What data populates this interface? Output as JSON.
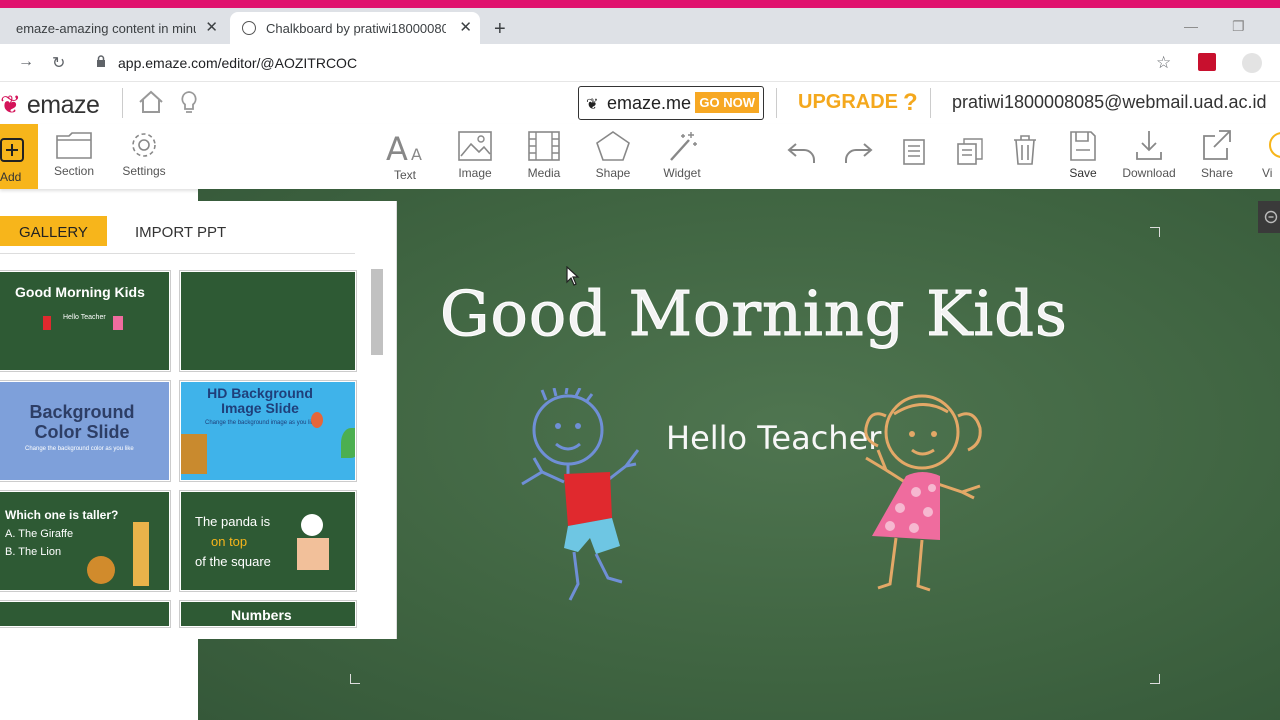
{
  "browser": {
    "tabs": [
      {
        "title": "emaze-amazing content in minut"
      },
      {
        "title": "Chalkboard by pratiwi18000080"
      }
    ],
    "url": "app.emaze.com/editor/@AOZITRCOC"
  },
  "header": {
    "logo": "emaze",
    "emaze_me": "emaze.me",
    "go_now": "GO NOW",
    "upgrade": "UPGRADE",
    "help": "?",
    "user_email": "pratiwi1800008085@webmail.uad.ac.id"
  },
  "toolbar": {
    "add": "Add",
    "section": "Section",
    "settings": "Settings",
    "text": "Text",
    "image": "Image",
    "media": "Media",
    "shape": "Shape",
    "widget": "Widget",
    "save": "Save",
    "download": "Download",
    "share": "Share",
    "view": "Vi"
  },
  "gallery": {
    "tabs": [
      "GALLERY",
      "IMPORT PPT"
    ],
    "thumbnails": [
      {
        "title": "Good Morning Kids",
        "sub": "Hello Teacher"
      },
      {
        "title": "",
        "sub": ""
      },
      {
        "title": "Background Color Slide",
        "sub": "Change the background color as you like"
      },
      {
        "title": "HD Background Image Slide",
        "sub": "Change the background image as you like"
      },
      {
        "title": "Which one is taller?",
        "a": "A. The Giraffe",
        "b": "B. The Lion"
      },
      {
        "title": "The panda is",
        "mid": "on top",
        "end": "of the square"
      },
      {
        "title": ""
      },
      {
        "title": "Numbers"
      }
    ]
  },
  "slide": {
    "title": "Good Morning Kids",
    "subtitle": "Hello Teacher"
  },
  "colors": {
    "accent": "#f7b51b",
    "brand": "#d4145a",
    "chalkboard": "#426843"
  }
}
